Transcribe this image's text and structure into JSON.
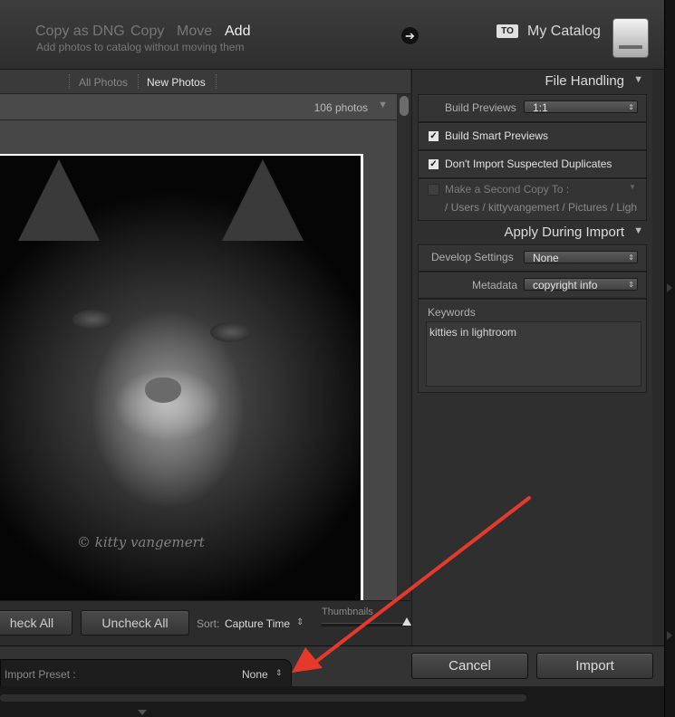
{
  "header": {
    "modes": [
      "Copy as DNG",
      "Copy",
      "Move",
      "Add"
    ],
    "active_mode": "Add",
    "mode_description": "Add photos to catalog without moving them",
    "to_badge": "TO",
    "destination": "My Catalog"
  },
  "filter_tabs": [
    "All Photos",
    "New Photos"
  ],
  "active_filter": "New Photos",
  "photo_count": "106 photos",
  "photo": {
    "watermark": "© kitty vangemert"
  },
  "grid_toolbar": {
    "check_all": "heck All",
    "uncheck_all": "Uncheck All",
    "sort_label": "Sort:",
    "sort_value": "Capture Time",
    "thumbnails_label": "Thumbnails"
  },
  "file_handling": {
    "title": "File Handling",
    "build_previews_label": "Build Previews",
    "build_previews_value": "1:1",
    "smart_previews": {
      "label": "Build Smart Previews",
      "checked": true
    },
    "no_duplicates": {
      "label": "Don't Import Suspected Duplicates",
      "checked": true
    },
    "second_copy": {
      "label": "Make a Second Copy To :",
      "checked": false,
      "path": "/ Users / kittyvangemert / Pictures / Ligh"
    }
  },
  "apply_during_import": {
    "title": "Apply During Import",
    "develop_label": "Develop Settings",
    "develop_value": "None",
    "metadata_label": "Metadata",
    "metadata_value": "copyright info",
    "keywords_label": "Keywords",
    "keywords_value": "kitties in lightroom"
  },
  "footer": {
    "preset_label": "Import Preset :",
    "preset_value": "None",
    "cancel": "Cancel",
    "import": "Import"
  }
}
